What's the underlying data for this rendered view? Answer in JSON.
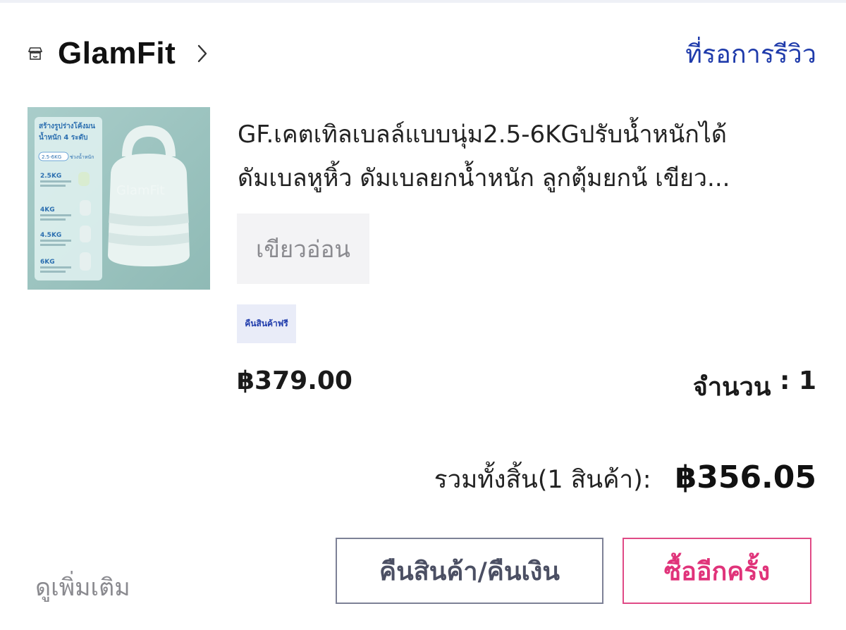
{
  "shop": {
    "name": "GlamFit",
    "icon": "shop-icon",
    "status": "ที่รอการรีวิว"
  },
  "product": {
    "title_line1": "GF.เคตเทิลเบลล์แบบนุ่ม2.5-6KGปรับน้ำหนักได้",
    "title_line2": "ดัมเบลหูหิ้ว ดัมเบลยกน้ำหนัก ลูกตุ้มยกน้ เขียว...",
    "variant": "เขียวอ่อน",
    "badge": "คืนสินค้าฟรี",
    "price": "฿379.00",
    "quantity_label": "จำนวน",
    "quantity_sep": " : ",
    "quantity_value": "1",
    "image": {
      "headline1": "สร้างรูปร่างโค้งมน",
      "headline2": "น้ำหนัก 4 ระดับ",
      "range_pill": "2.5-6KG",
      "range_text": "ช่วงน้ำหนัก",
      "levels": [
        "2.5KG",
        "4KG",
        "4.5KG",
        "6KG"
      ],
      "watermark": "GlamFit"
    }
  },
  "summary": {
    "total_label": "รวมทั้งสิ้น(1 สินค้า):",
    "total_value": "฿356.05"
  },
  "actions": {
    "more": "ดูเพิ่มเติม",
    "return_refund": "คืนสินค้า/คืนเงิน",
    "buy_again": "ซื้ออีกครั้ง"
  },
  "colors": {
    "status_blue": "#1f3bab",
    "buy_again_pink": "#e0337a",
    "badge_bg": "#e9ecf8"
  }
}
